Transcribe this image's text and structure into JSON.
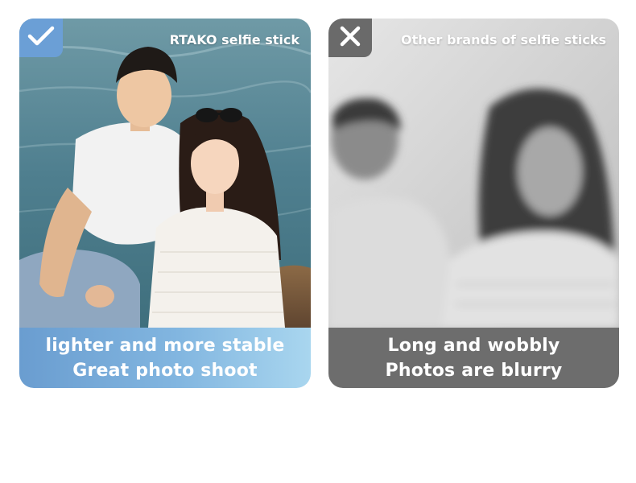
{
  "left_panel": {
    "badge_icon": "check-icon",
    "brand_label": "RTAKO selfie stick",
    "caption_line1": "lighter and more stable",
    "caption_line2": "Great photo shoot",
    "accent_color": "#6b9fd6"
  },
  "right_panel": {
    "badge_icon": "close-icon",
    "brand_label": "Other brands of selfie sticks",
    "caption_line1": "Long and wobbly",
    "caption_line2": "Photos are blurry",
    "accent_color": "#6a6a6a"
  }
}
